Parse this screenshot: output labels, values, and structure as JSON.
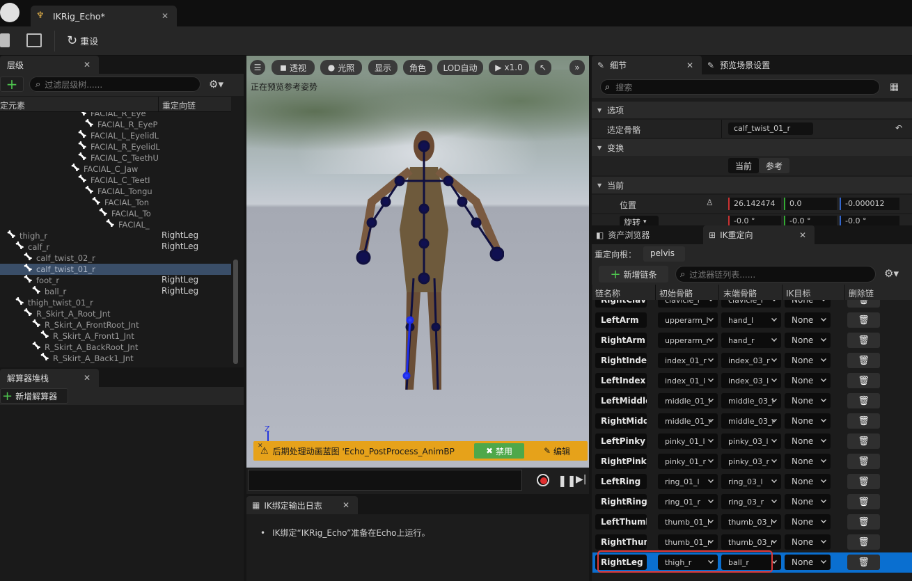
{
  "app": {
    "doc_tab": "IKRig_Echo*"
  },
  "toolbar": {
    "reset_label": "重设"
  },
  "hierarchy": {
    "tab": "层级",
    "filter_placeholder": "过滤层级树......",
    "col_element": "定元素",
    "col_chain": "重定向链",
    "rows": [
      {
        "label": "FACIAL_R_Eye",
        "chain": ""
      },
      {
        "label": "FACIAL_R_EyeP",
        "chain": ""
      },
      {
        "label": "FACIAL_L_EyelidL",
        "chain": ""
      },
      {
        "label": "FACIAL_R_EyelidL",
        "chain": ""
      },
      {
        "label": "FACIAL_C_TeethU",
        "chain": ""
      },
      {
        "label": "FACIAL_C_Jaw",
        "chain": ""
      },
      {
        "label": "FACIAL_C_TeetI",
        "chain": ""
      },
      {
        "label": "FACIAL_Tongu",
        "chain": ""
      },
      {
        "label": "FACIAL_Ton",
        "chain": ""
      },
      {
        "label": "FACIAL_To",
        "chain": ""
      },
      {
        "label": "FACIAL_",
        "chain": ""
      },
      {
        "label": "thigh_r",
        "chain": "RightLeg"
      },
      {
        "label": "calf_r",
        "chain": "RightLeg"
      },
      {
        "label": "calf_twist_02_r",
        "chain": ""
      },
      {
        "label": "calf_twist_01_r",
        "chain": ""
      },
      {
        "label": "foot_r",
        "chain": "RightLeg"
      },
      {
        "label": "ball_r",
        "chain": "RightLeg"
      },
      {
        "label": "thigh_twist_01_r",
        "chain": ""
      },
      {
        "label": "R_Skirt_A_Root_Jnt",
        "chain": ""
      },
      {
        "label": "R_Skirt_A_FrontRoot_Jnt",
        "chain": ""
      },
      {
        "label": "R_Skirt_A_Front1_Jnt",
        "chain": ""
      },
      {
        "label": "R_Skirt_A_BackRoot_Jnt",
        "chain": ""
      },
      {
        "label": "R_Skirt_A_Back1_Jnt",
        "chain": ""
      }
    ]
  },
  "solver": {
    "tab": "解算器堆栈",
    "add_label": "新增解算器"
  },
  "viewport": {
    "buttons": [
      "透视",
      "光照",
      "显示",
      "角色",
      "LOD自动",
      "x1.0"
    ],
    "status": "正在预览参考姿势",
    "axis": "Z",
    "warning_text": "后期处理动画蓝图 'Echo_PostProcess_AnimBP",
    "disable_label": "禁用",
    "edit_label": "编辑"
  },
  "log": {
    "tab": "IK绑定输出日志",
    "message": "IK绑定“IKRig_Echo”准备在Echo上运行。"
  },
  "details": {
    "tab": "细节",
    "tab2": "预览场景设置",
    "search_placeholder": "搜索",
    "section_options": "选项",
    "selected_bone_label": "选定骨骼",
    "selected_bone_value": "calf_twist_01_r",
    "section_transform": "变换",
    "toggle_current": "当前",
    "toggle_ref": "参考",
    "section_current": "当前",
    "position_label": "位置",
    "pos_x": "26.142474",
    "pos_y": "0.0",
    "pos_z": "-0.000012",
    "rotation_label": "旋转",
    "rot_x": "-0.0 °",
    "rot_y": "-0.0 °",
    "rot_z": "-0.0 °"
  },
  "retarget": {
    "tab_assets": "资产浏览器",
    "tab": "IK重定向",
    "root_label": "重定向根：",
    "root_value": "pelvis",
    "add_chain_label": "新增链条",
    "filter_placeholder": "过滤器链列表......",
    "headers": [
      "链名称",
      "初始骨骼",
      "末端骨骼",
      "IK目标",
      "删除链"
    ],
    "rows": [
      {
        "name": "RightClavicle",
        "start": "clavicle_r",
        "end": "clavicle_r",
        "ik": "None"
      },
      {
        "name": "LeftArm",
        "start": "upperarm_l",
        "end": "hand_l",
        "ik": "None"
      },
      {
        "name": "RightArm",
        "start": "upperarm_r",
        "end": "hand_r",
        "ik": "None"
      },
      {
        "name": "RightIndex",
        "start": "index_01_r",
        "end": "index_03_r",
        "ik": "None"
      },
      {
        "name": "LeftIndex",
        "start": "index_01_l",
        "end": "index_03_l",
        "ik": "None"
      },
      {
        "name": "LeftMiddle",
        "start": "middle_01_l",
        "end": "middle_03_l",
        "ik": "None"
      },
      {
        "name": "RightMiddle",
        "start": "middle_01_r",
        "end": "middle_03_r",
        "ik": "None"
      },
      {
        "name": "LeftPinky",
        "start": "pinky_01_l",
        "end": "pinky_03_l",
        "ik": "None"
      },
      {
        "name": "RightPinky",
        "start": "pinky_01_r",
        "end": "pinky_03_r",
        "ik": "None"
      },
      {
        "name": "LeftRing",
        "start": "ring_01_l",
        "end": "ring_03_l",
        "ik": "None"
      },
      {
        "name": "RightRing",
        "start": "ring_01_r",
        "end": "ring_03_r",
        "ik": "None"
      },
      {
        "name": "LeftThumb",
        "start": "thumb_01_l",
        "end": "thumb_03_l",
        "ik": "None"
      },
      {
        "name": "RightThumb",
        "start": "thumb_01_r",
        "end": "thumb_03_r",
        "ik": "None"
      },
      {
        "name": "RightLeg",
        "start": "thigh_r",
        "end": "ball_r",
        "ik": "None"
      }
    ]
  }
}
